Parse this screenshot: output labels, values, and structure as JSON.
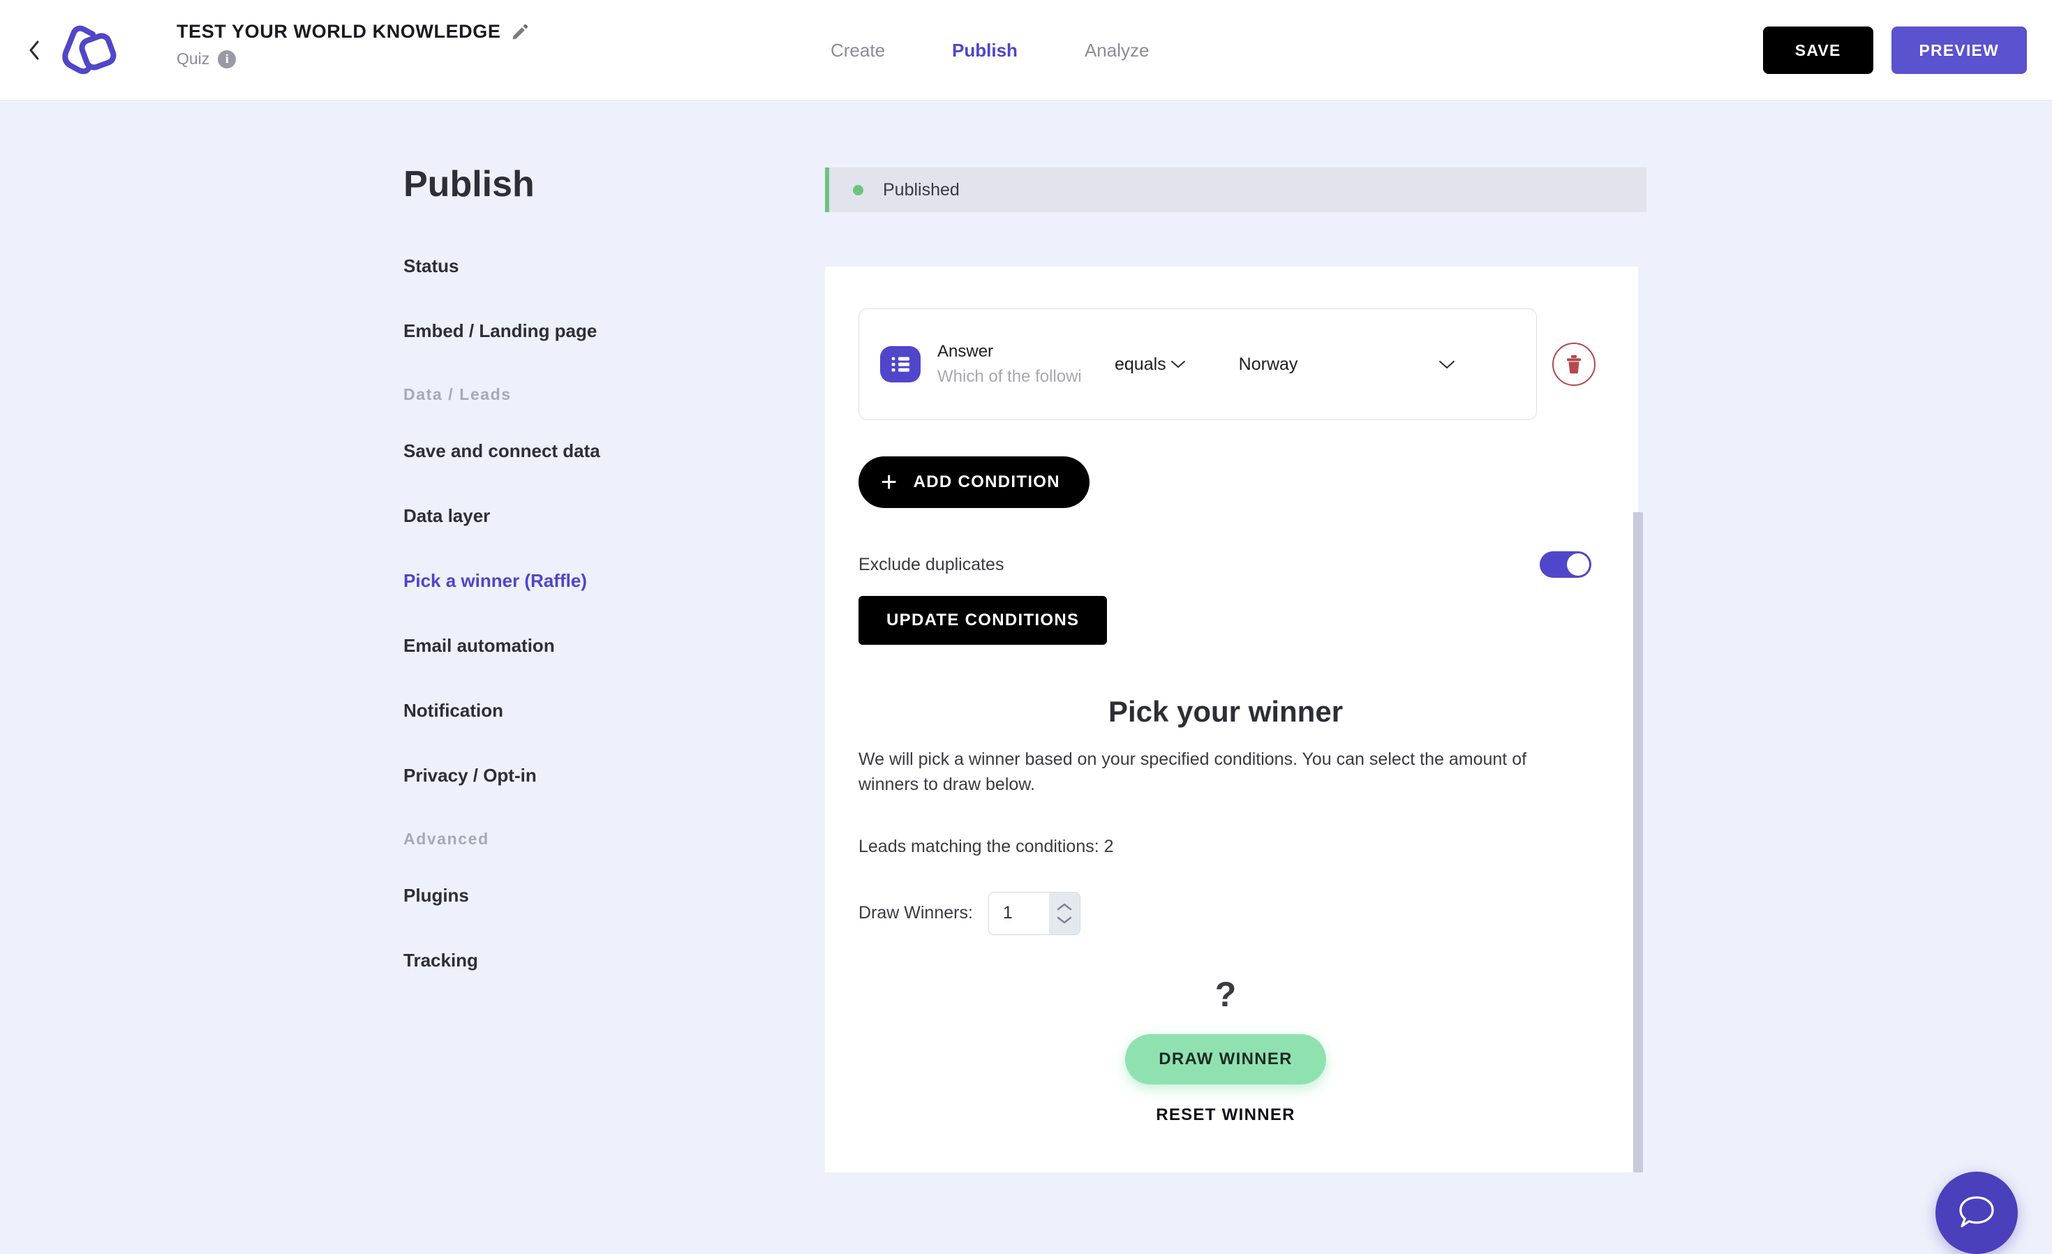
{
  "header": {
    "back_label": "Back",
    "project_title": "TEST YOUR WORLD KNOWLEDGE",
    "project_type": "Quiz",
    "info_glyph": "i",
    "nav": [
      {
        "label": "Create",
        "active": false
      },
      {
        "label": "Publish",
        "active": true
      },
      {
        "label": "Analyze",
        "active": false
      }
    ],
    "save_label": "SAVE",
    "preview_label": "PREVIEW"
  },
  "sidebar": {
    "title": "Publish",
    "items": [
      {
        "label": "Status",
        "type": "item",
        "active": false
      },
      {
        "label": "Embed / Landing page",
        "type": "item",
        "active": false
      },
      {
        "label": "Data / Leads",
        "type": "group"
      },
      {
        "label": "Save and connect data",
        "type": "item",
        "active": false
      },
      {
        "label": "Data layer",
        "type": "item",
        "active": false
      },
      {
        "label": "Pick a winner (Raffle)",
        "type": "item",
        "active": true
      },
      {
        "label": "Email automation",
        "type": "item",
        "active": false
      },
      {
        "label": "Notification",
        "type": "item",
        "active": false
      },
      {
        "label": "Privacy / Opt-in",
        "type": "item",
        "active": false
      },
      {
        "label": "Advanced",
        "type": "group"
      },
      {
        "label": "Plugins",
        "type": "item",
        "active": false
      },
      {
        "label": "Tracking",
        "type": "item",
        "active": false
      }
    ]
  },
  "status_banner": {
    "text": "Published",
    "dot_color": "#6dc47f",
    "bar_color": "#6dc47f"
  },
  "conditions": {
    "row": {
      "icon_name": "multiple-choice-icon",
      "field_label": "Answer",
      "question_label": "Which of the followi",
      "operator": "equals",
      "value": "Norway"
    },
    "add_condition_label": "ADD CONDITION",
    "add_condition_plus": "+",
    "exclude_duplicates_label": "Exclude duplicates",
    "exclude_duplicates_on": true,
    "update_conditions_label": "UPDATE CONDITIONS"
  },
  "winner": {
    "title": "Pick your winner",
    "description": "We will pick a winner based on your specified conditions. You can select the amount of winners to draw below.",
    "leads_line": "Leads matching the conditions: 2",
    "draw_winners_label": "Draw Winners:",
    "draw_winners_value": "1",
    "placeholder_glyph": "?",
    "draw_winner_label": "DRAW WINNER",
    "reset_winner_label": "RESET WINNER"
  },
  "chat": {
    "icon_name": "chat-bubble-icon",
    "color": "#4a40bb"
  },
  "colors": {
    "accent_purple": "#4f46cb",
    "preview_purple": "#5b52cf",
    "page_bg": "#eef0fb",
    "green": "#8fe2b0",
    "danger_red": "#b4484f"
  }
}
